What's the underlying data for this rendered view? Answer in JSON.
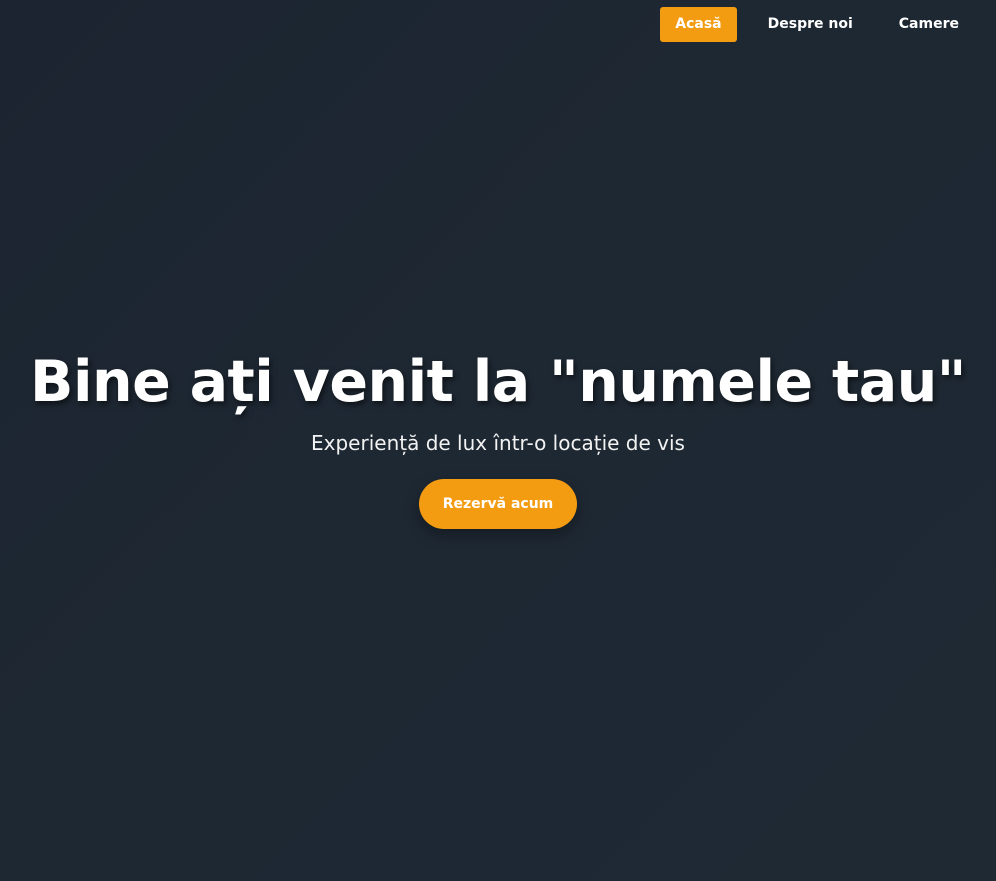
{
  "nav": {
    "items": [
      {
        "label": "Acasă",
        "active": true
      },
      {
        "label": "Despre noi",
        "active": false
      },
      {
        "label": "Camere",
        "active": false
      }
    ]
  },
  "hero": {
    "title": "Bine ați venit la \"numele tau\"",
    "subtitle": "Experiență de lux într-o locație de vis",
    "cta_label": "Rezervă acum"
  },
  "colors": {
    "accent": "#f39c12",
    "background": "#1e2833",
    "text": "#ffffff"
  }
}
